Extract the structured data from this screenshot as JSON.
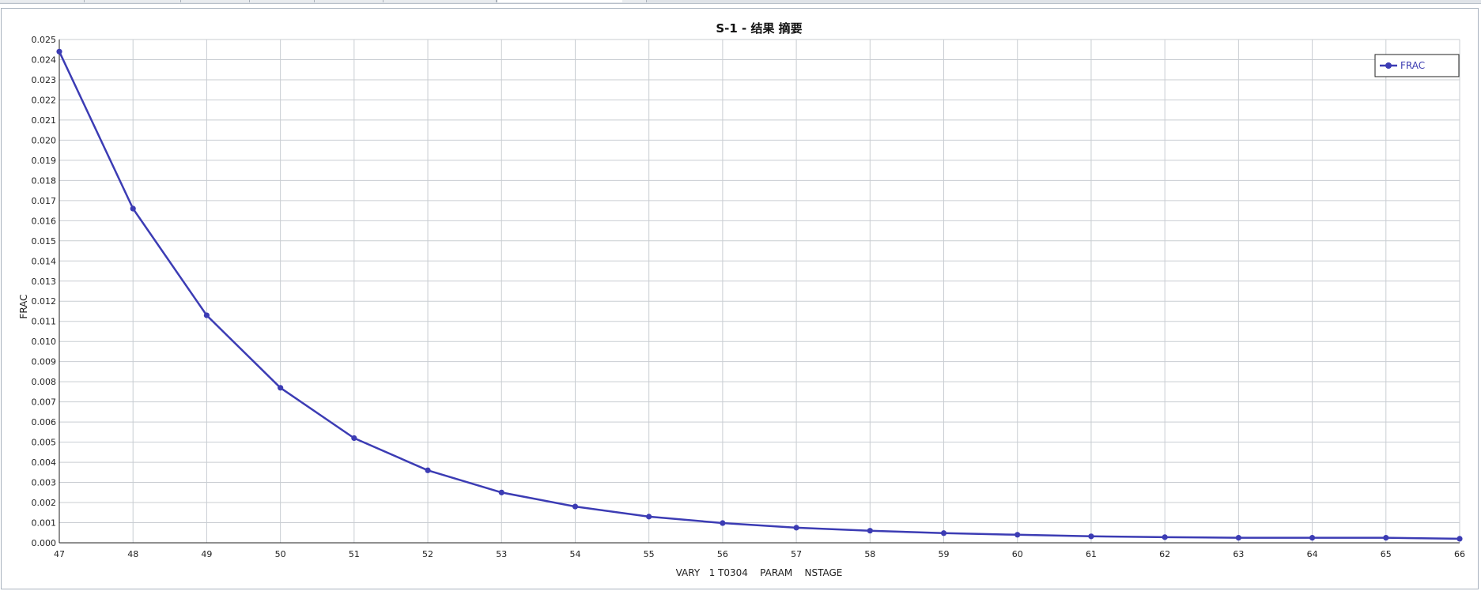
{
  "window": {
    "tab_count": 8
  },
  "chart_data": {
    "type": "line",
    "title": "S-1 - 结果 摘要",
    "xlabel": "VARY   1 T0304    PARAM    NSTAGE",
    "ylabel": "FRAC",
    "xlim": [
      47,
      66
    ],
    "ylim": [
      0,
      0.025
    ],
    "x_ticks": [
      47,
      48,
      49,
      50,
      51,
      52,
      53,
      54,
      55,
      56,
      57,
      58,
      59,
      60,
      61,
      62,
      63,
      64,
      65,
      66
    ],
    "y_ticks": [
      "0.000",
      "0.001",
      "0.002",
      "0.003",
      "0.004",
      "0.005",
      "0.006",
      "0.007",
      "0.008",
      "0.009",
      "0.010",
      "0.011",
      "0.012",
      "0.013",
      "0.014",
      "0.015",
      "0.016",
      "0.017",
      "0.018",
      "0.019",
      "0.020",
      "0.021",
      "0.022",
      "0.023",
      "0.024",
      "0.025"
    ],
    "grid": true,
    "legend_position": "top-right",
    "series": [
      {
        "name": "FRAC",
        "color": "#3c3cb4",
        "x": [
          47,
          48,
          49,
          50,
          51,
          52,
          53,
          54,
          55,
          56,
          57,
          58,
          59,
          60,
          61,
          62,
          63,
          64,
          65,
          66
        ],
        "y": [
          0.0244,
          0.0166,
          0.0113,
          0.0077,
          0.0052,
          0.0036,
          0.0025,
          0.0018,
          0.0013,
          0.00098,
          0.00075,
          0.0006,
          0.00048,
          0.0004,
          0.00032,
          0.00028,
          0.00025,
          0.00025,
          0.00025,
          0.0002
        ]
      }
    ]
  }
}
